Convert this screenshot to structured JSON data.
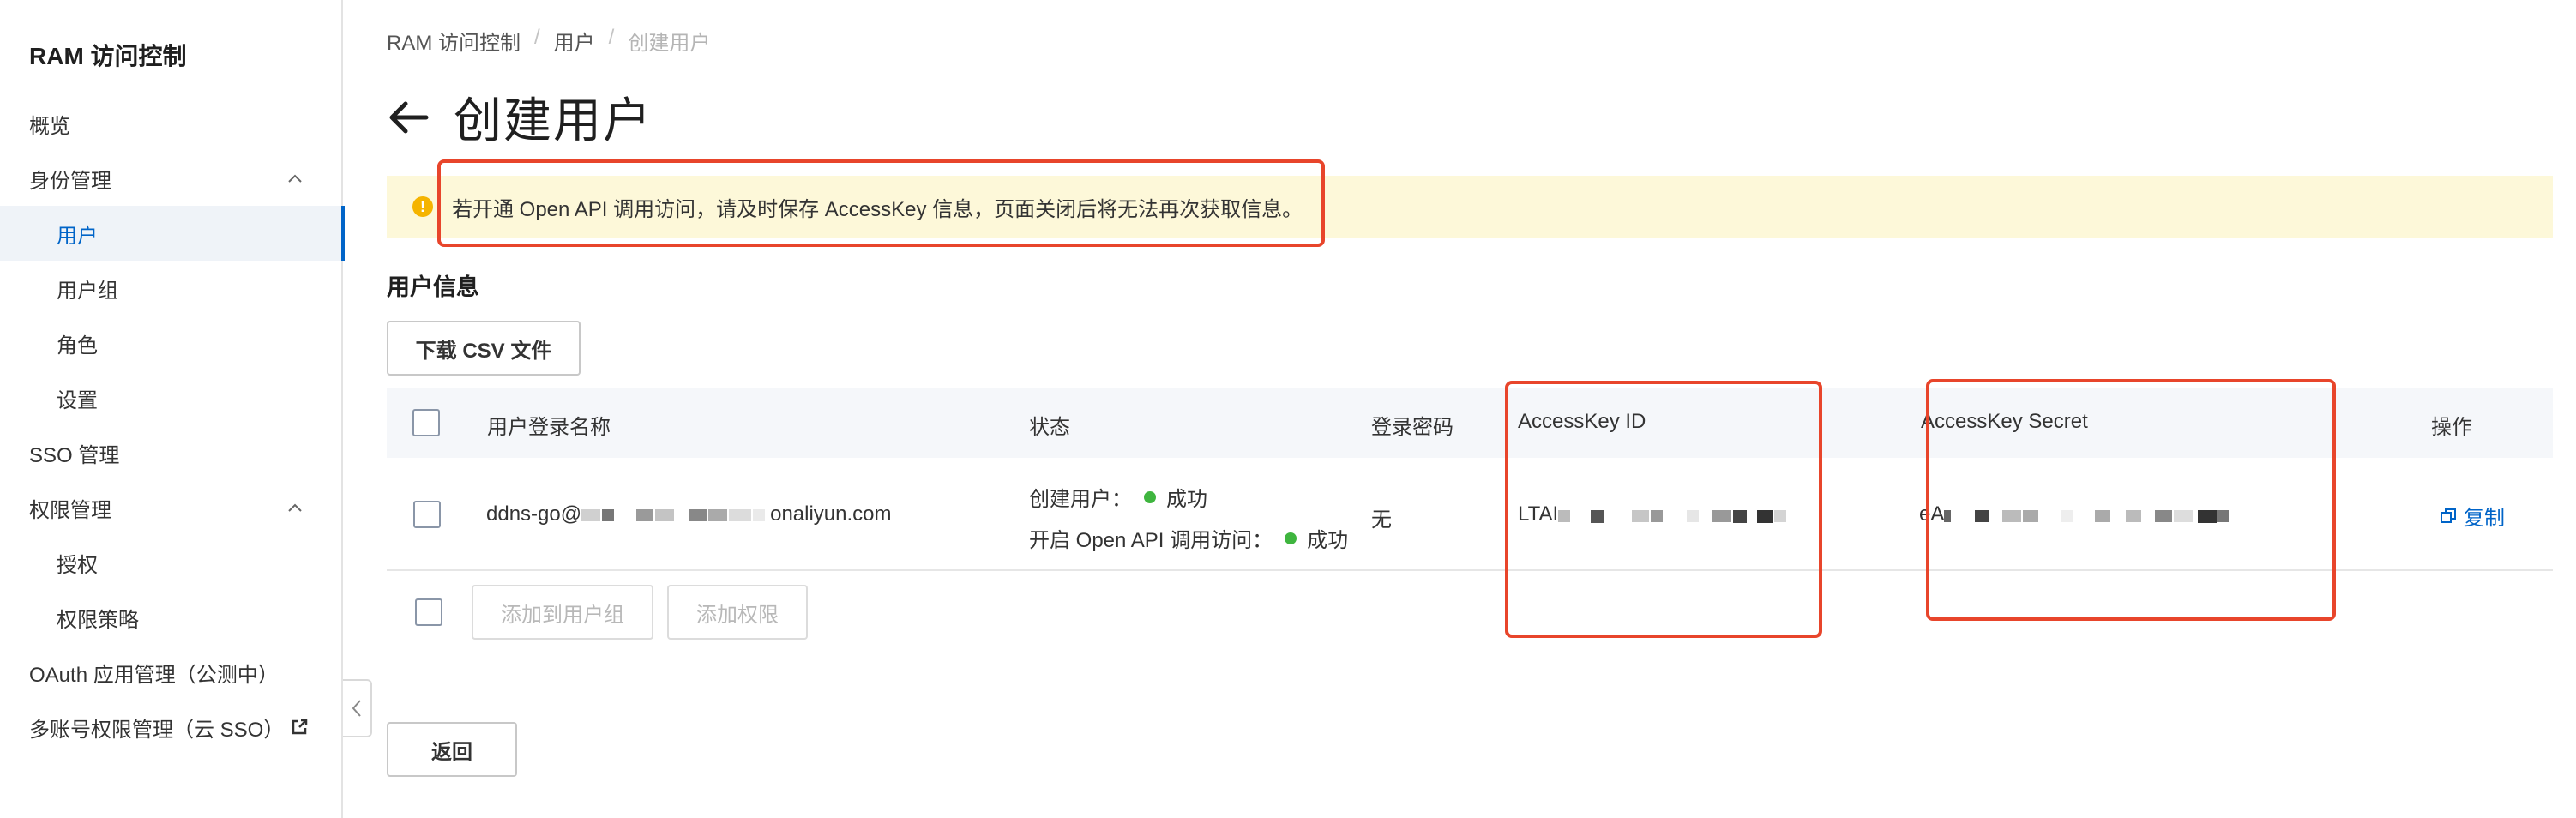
{
  "sidebar": {
    "title": "RAM 访问控制",
    "items": [
      {
        "label": "概览"
      },
      {
        "label": "身份管理"
      },
      {
        "label": "用户"
      },
      {
        "label": "用户组"
      },
      {
        "label": "角色"
      },
      {
        "label": "设置"
      },
      {
        "label": "SSO 管理"
      },
      {
        "label": "权限管理"
      },
      {
        "label": "授权"
      },
      {
        "label": "权限策略"
      },
      {
        "label": "OAuth 应用管理（公测中）"
      },
      {
        "label": "多账号权限管理（云 SSO）"
      }
    ]
  },
  "breadcrumb": [
    "RAM 访问控制",
    "用户",
    "创建用户"
  ],
  "page": {
    "title": "创建用户",
    "alert": "若开通 Open API 调用访问，请及时保存 AccessKey 信息，页面关闭后将无法再次获取信息。",
    "section_title": "用户信息",
    "download_button": "下载 CSV 文件",
    "back_button": "返回"
  },
  "table": {
    "columns": [
      "用户登录名称",
      "状态",
      "登录密码",
      "AccessKey ID",
      "AccessKey Secret",
      "操作"
    ],
    "row": {
      "login_prefix": "ddns-go@",
      "login_suffix": "onaliyun.com",
      "status_create_label": "创建用户：",
      "status_create_value": "成功",
      "status_api_label": "开启 Open API 调用访问：",
      "status_api_value": "成功",
      "password": "无",
      "access_key_id_prefix": "LTAI",
      "access_key_secret_prefix": "eA",
      "action": "复制"
    },
    "footer_buttons": [
      "添加到用户组",
      "添加权限"
    ]
  },
  "colors": {
    "accent": "#0064c8",
    "success": "#3fb53f",
    "alert_bg": "#fdf8d9",
    "highlight": "#e8452b"
  }
}
